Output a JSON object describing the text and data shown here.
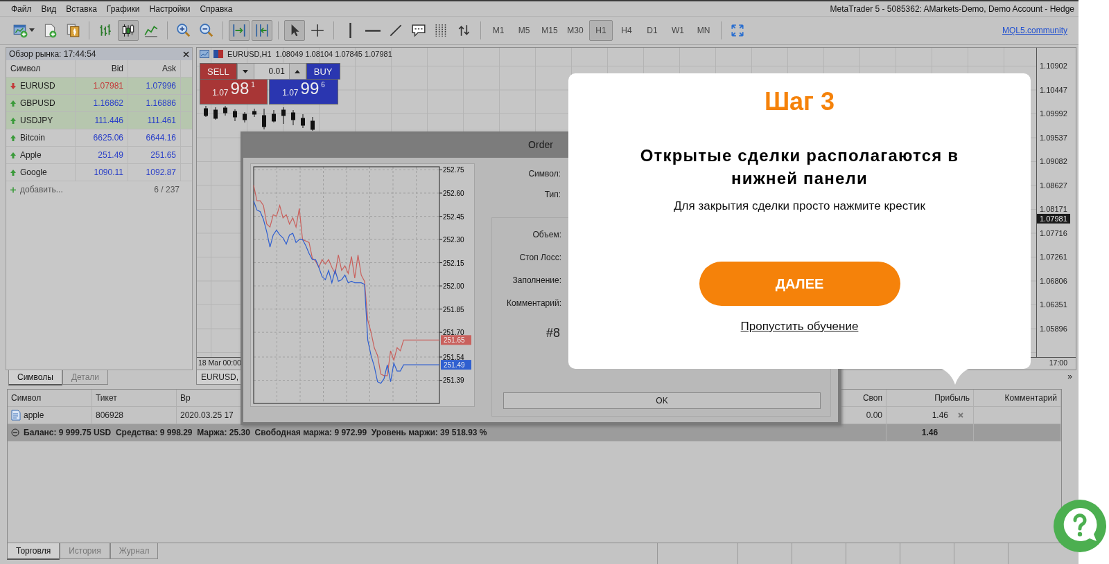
{
  "menu": [
    "Файл",
    "Вид",
    "Вставка",
    "Графики",
    "Настройки",
    "Справка"
  ],
  "window_title": "MetaTrader 5 - 5085362: AMarkets-Demo, Demo Account - Hedge",
  "toolbar_groups": [
    {
      "tools": [
        {
          "kind": "new-chart",
          "selected": false
        },
        {
          "kind": "new-document",
          "selected": false
        },
        {
          "kind": "dollar-document",
          "selected": false
        }
      ]
    },
    {
      "tools": [
        {
          "kind": "bars",
          "selected": false
        },
        {
          "kind": "candles",
          "selected": true
        },
        {
          "kind": "line",
          "selected": false
        }
      ]
    },
    {
      "tools": [
        {
          "kind": "zoom-in",
          "selected": false
        },
        {
          "kind": "zoom-out",
          "selected": false
        }
      ]
    },
    {
      "tools": [
        {
          "kind": "chart-shift",
          "selected": true
        },
        {
          "kind": "auto-scroll",
          "selected": true
        }
      ]
    },
    {
      "tools": [
        {
          "kind": "cursor",
          "selected": true
        },
        {
          "kind": "crosshair",
          "selected": false
        }
      ]
    },
    {
      "tools": [
        {
          "kind": "vertical-line",
          "selected": false
        },
        {
          "kind": "horizontal-line",
          "selected": false
        },
        {
          "kind": "trend-line",
          "selected": false
        },
        {
          "kind": "comment",
          "selected": false
        },
        {
          "kind": "dotted-grid",
          "selected": false
        },
        {
          "kind": "swap-arrows",
          "selected": false
        }
      ]
    },
    {
      "tools": [
        {
          "kind": "timeframe",
          "label": "M1",
          "selected": false
        },
        {
          "kind": "timeframe",
          "label": "M5",
          "selected": false
        },
        {
          "kind": "timeframe",
          "label": "M15",
          "selected": false
        },
        {
          "kind": "timeframe",
          "label": "M30",
          "selected": false
        },
        {
          "kind": "timeframe",
          "label": "H1",
          "selected": true
        },
        {
          "kind": "timeframe",
          "label": "H4",
          "selected": false
        },
        {
          "kind": "timeframe",
          "label": "D1",
          "selected": false
        },
        {
          "kind": "timeframe",
          "label": "W1",
          "selected": false
        },
        {
          "kind": "timeframe",
          "label": "MN",
          "selected": false
        }
      ]
    },
    {
      "tools": [
        {
          "kind": "expand",
          "selected": false
        }
      ]
    }
  ],
  "community_link": "MQL5.community",
  "market_watch": {
    "title": "Обзор рынка: 17:44:54",
    "columns": [
      "Символ",
      "Bid",
      "Ask"
    ],
    "rows": [
      {
        "symbol": "EURUSD",
        "bid": "1.07981",
        "ask": "1.07996",
        "rising": false,
        "highlighted": true
      },
      {
        "symbol": "GBPUSD",
        "bid": "1.16862",
        "ask": "1.16886",
        "rising": true,
        "highlighted": true
      },
      {
        "symbol": "USDJPY",
        "bid": "111.446",
        "ask": "111.461",
        "rising": true,
        "highlighted": true
      },
      {
        "symbol": "Bitcoin",
        "bid": "6625.06",
        "ask": "6644.16",
        "rising": true,
        "highlighted": false
      },
      {
        "symbol": "Apple",
        "bid": "251.49",
        "ask": "251.65",
        "rising": true,
        "highlighted": false
      },
      {
        "symbol": "Google",
        "bid": "1090.11",
        "ask": "1092.87",
        "rising": true,
        "highlighted": false
      }
    ],
    "add_label": "добавить...",
    "count": "6 / 237",
    "tabs": [
      {
        "label": "Символы",
        "selected": true
      },
      {
        "label": "Детали",
        "selected": false
      }
    ]
  },
  "chart": {
    "title": "EURUSD,H1",
    "ohlc": "1.08049 1.08104 1.07845 1.07981",
    "sell": {
      "label": "SELL",
      "prefix": "1.07",
      "main": "98",
      "suffix": "1"
    },
    "buy": {
      "label": "BUY",
      "prefix": "1.07",
      "main": "99",
      "suffix": "6"
    },
    "volume": "0.01",
    "price_axis": [
      "1.10902",
      "1.10447",
      "1.09992",
      "1.09537",
      "1.09082",
      "1.08627",
      "1.08171",
      "1.07716",
      "1.07261",
      "1.06806",
      "1.06351",
      "1.05896"
    ],
    "current_price": "1.07981",
    "time_axis": [
      "18 Mar 00:00",
      "17:00"
    ],
    "tab": "EURUSD,",
    "more_tabs": "»"
  },
  "order_dialog": {
    "title": "Order",
    "top_fields": [
      "Символ:",
      "Тип:"
    ],
    "fields": [
      "Объем:",
      "Стоп Лосс:",
      "Заполнение:",
      "Комментарий:"
    ],
    "ticket": "#8",
    "ok": "OK",
    "last_prices": [
      {
        "label": "251.65",
        "color": "#c9605c"
      },
      {
        "label": "251.49",
        "color": "#2f5fd0"
      }
    ],
    "chart_data": {
      "type": "line",
      "grid": true,
      "ylim": [
        251.24,
        252.77
      ],
      "yticks": [
        {
          "value": 252.75,
          "label": "252.75"
        },
        {
          "value": 252.6,
          "label": "252.60"
        },
        {
          "value": 252.45,
          "label": "252.45"
        },
        {
          "value": 252.3,
          "label": "252.30"
        },
        {
          "value": 252.15,
          "label": "252.15"
        },
        {
          "value": 252.0,
          "label": "252.00"
        },
        {
          "value": 251.85,
          "label": "251.85"
        },
        {
          "value": 251.7,
          "label": "251.70"
        },
        {
          "value": 251.54,
          "label": "251.54"
        },
        {
          "value": 251.39,
          "label": "251.39"
        }
      ],
      "series": [
        {
          "color": "#c9605c",
          "values": [
            252.65,
            252.55,
            252.55,
            252.52,
            252.4,
            252.38,
            252.46,
            252.45,
            252.52,
            252.44,
            252.46,
            252.4,
            252.44,
            252.38,
            252.5,
            252.3,
            252.29,
            252.28,
            252.18,
            252.16,
            252.12,
            252.17,
            252.14,
            252.17,
            252.12,
            252.08,
            252.2,
            252.1,
            252.13,
            252.08,
            252.19,
            252.05,
            252.2,
            252.07,
            252.03,
            251.78,
            251.7,
            251.6,
            251.55,
            251.43,
            251.42,
            251.42,
            251.58,
            251.52,
            251.6,
            251.58,
            251.65,
            251.65,
            251.65,
            251.65,
            251.65,
            251.65,
            251.65,
            251.65,
            251.65,
            251.65,
            251.65,
            251.65
          ]
        },
        {
          "color": "#2f5fd0",
          "values": [
            252.55,
            252.49,
            252.48,
            252.43,
            252.35,
            252.25,
            252.33,
            252.36,
            252.33,
            252.31,
            252.27,
            252.33,
            252.34,
            252.28,
            252.3,
            252.3,
            252.26,
            252.21,
            252.17,
            252.17,
            252.12,
            252.06,
            252.04,
            252.1,
            252.02,
            252.1,
            252.03,
            252.04,
            252.07,
            252.02,
            252.03,
            252.02,
            252.02,
            252.02,
            252.01,
            251.65,
            251.55,
            251.48,
            251.38,
            251.37,
            251.4,
            251.49,
            251.38,
            251.5,
            251.45,
            251.45,
            251.49,
            251.49,
            251.49,
            251.49,
            251.49,
            251.49,
            251.49,
            251.49,
            251.49,
            251.49,
            251.49,
            251.49
          ]
        }
      ]
    }
  },
  "terminal": {
    "columns": [
      "Символ",
      "Тикет",
      "Вр",
      "Своп",
      "Прибыль",
      "Комментарий"
    ],
    "rows": [
      {
        "symbol": "apple",
        "ticket": "806928",
        "time": "2020.03.25 17",
        "swap": "0.00",
        "profit": "1.46"
      }
    ],
    "summary": {
      "text": "Баланс: 9 999.75 USD  Средства: 9 998.29  Маржа: 25.30  Свободная маржа: 9 972.99  Уровень маржи: 39 518.93 %",
      "profit": "1.46"
    },
    "tabs": [
      {
        "label": "Торговля",
        "selected": true
      },
      {
        "label": "История",
        "selected": false
      },
      {
        "label": "Журнал",
        "selected": false
      }
    ]
  },
  "tutorial": {
    "step": "Шаг 3",
    "heading": "Открытые сделки располагаются в нижней панели",
    "text": "Для закрытия сделки просто нажмите крестик",
    "button": "ДАЛЕЕ",
    "skip_link": "Пропустить обучение"
  }
}
